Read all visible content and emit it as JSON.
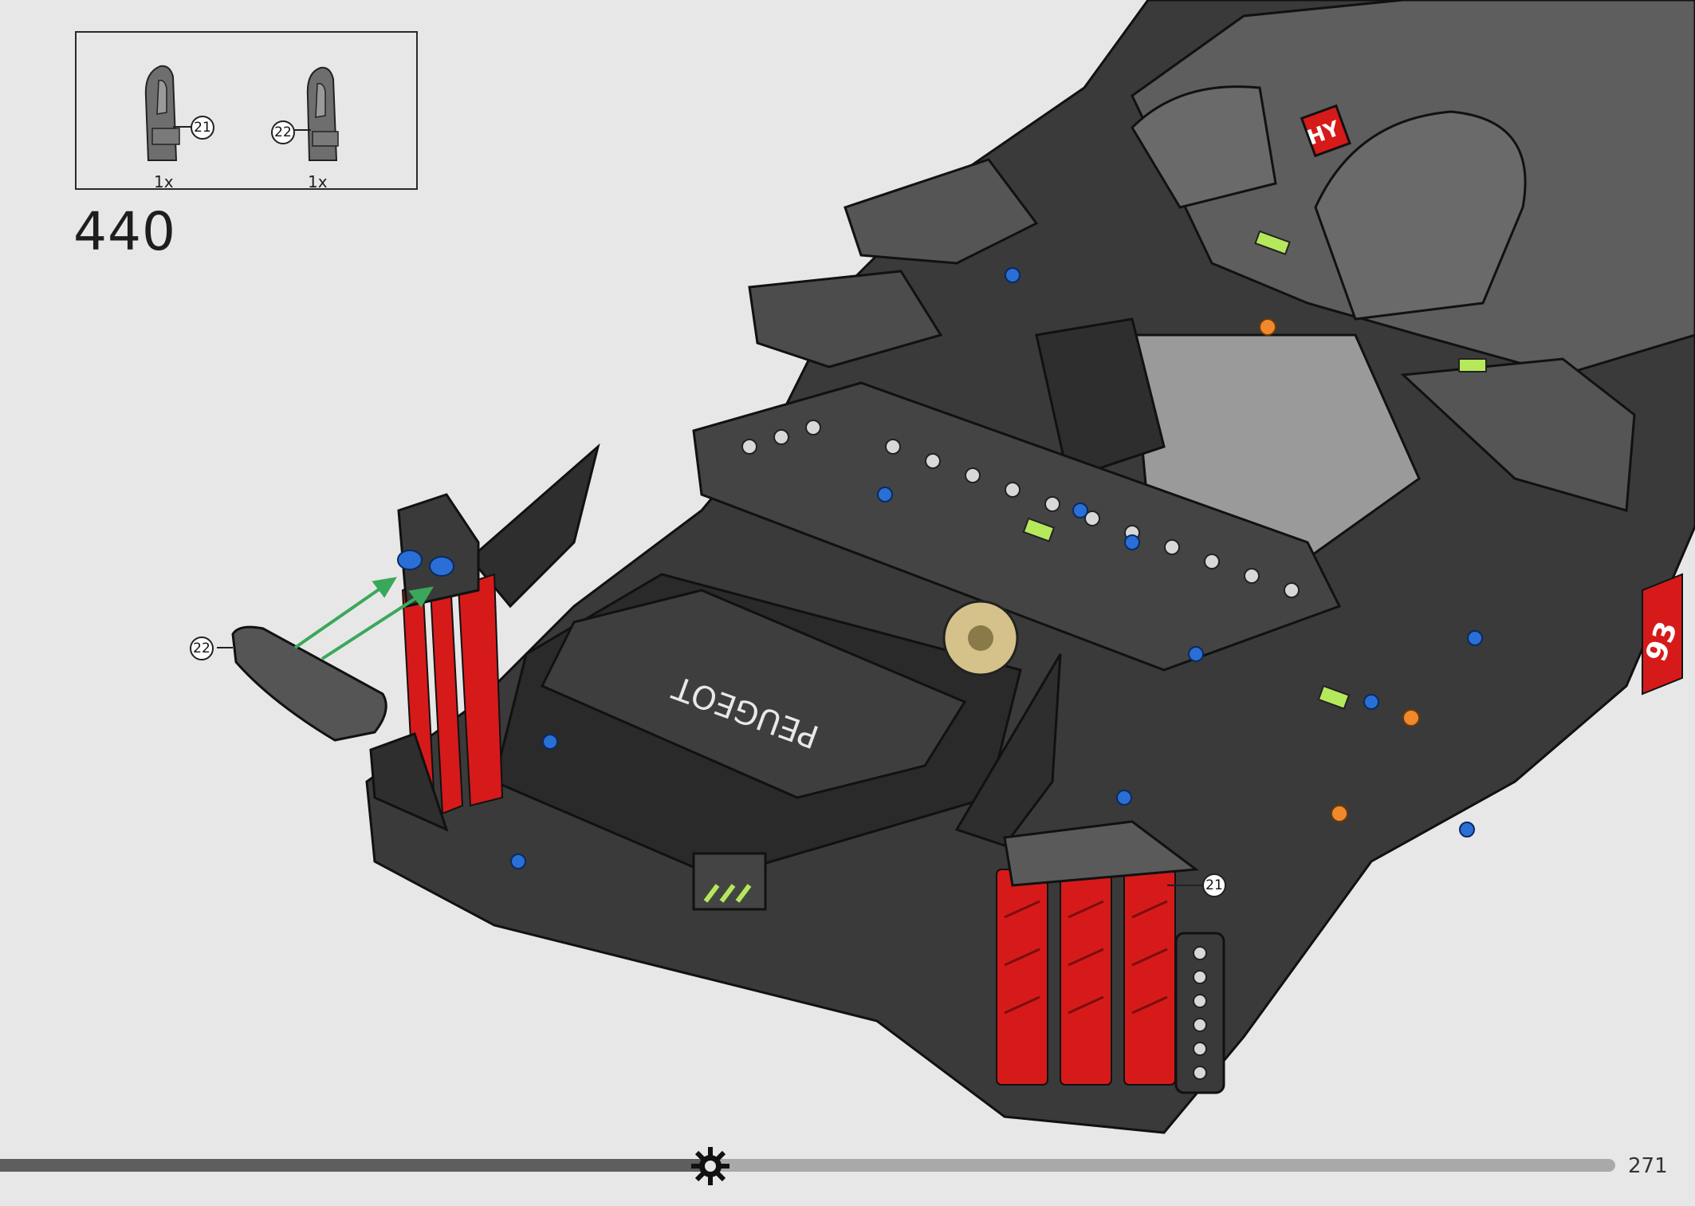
{
  "parts_list": {
    "items": [
      {
        "callout": "21",
        "quantity": "1x"
      },
      {
        "callout": "22",
        "quantity": "1x"
      }
    ]
  },
  "step": {
    "number": "440"
  },
  "callouts": {
    "part_22": "22",
    "part_21": "21"
  },
  "model": {
    "brand_text": "PEUGEOT",
    "badge_text": "HY",
    "race_number": "93"
  },
  "colors": {
    "background": "#e7e7e7",
    "part_dark_gray": "#5a5a5a",
    "part_black": "#2b2b2b",
    "accent_red": "#d61a1a",
    "accent_blue": "#2a6fd6",
    "arrow_green": "#3aa85a",
    "lime": "#b6e85c"
  },
  "progress": {
    "fraction": 0.44,
    "marker_icon": "gear-icon"
  },
  "page": {
    "number": "271"
  }
}
